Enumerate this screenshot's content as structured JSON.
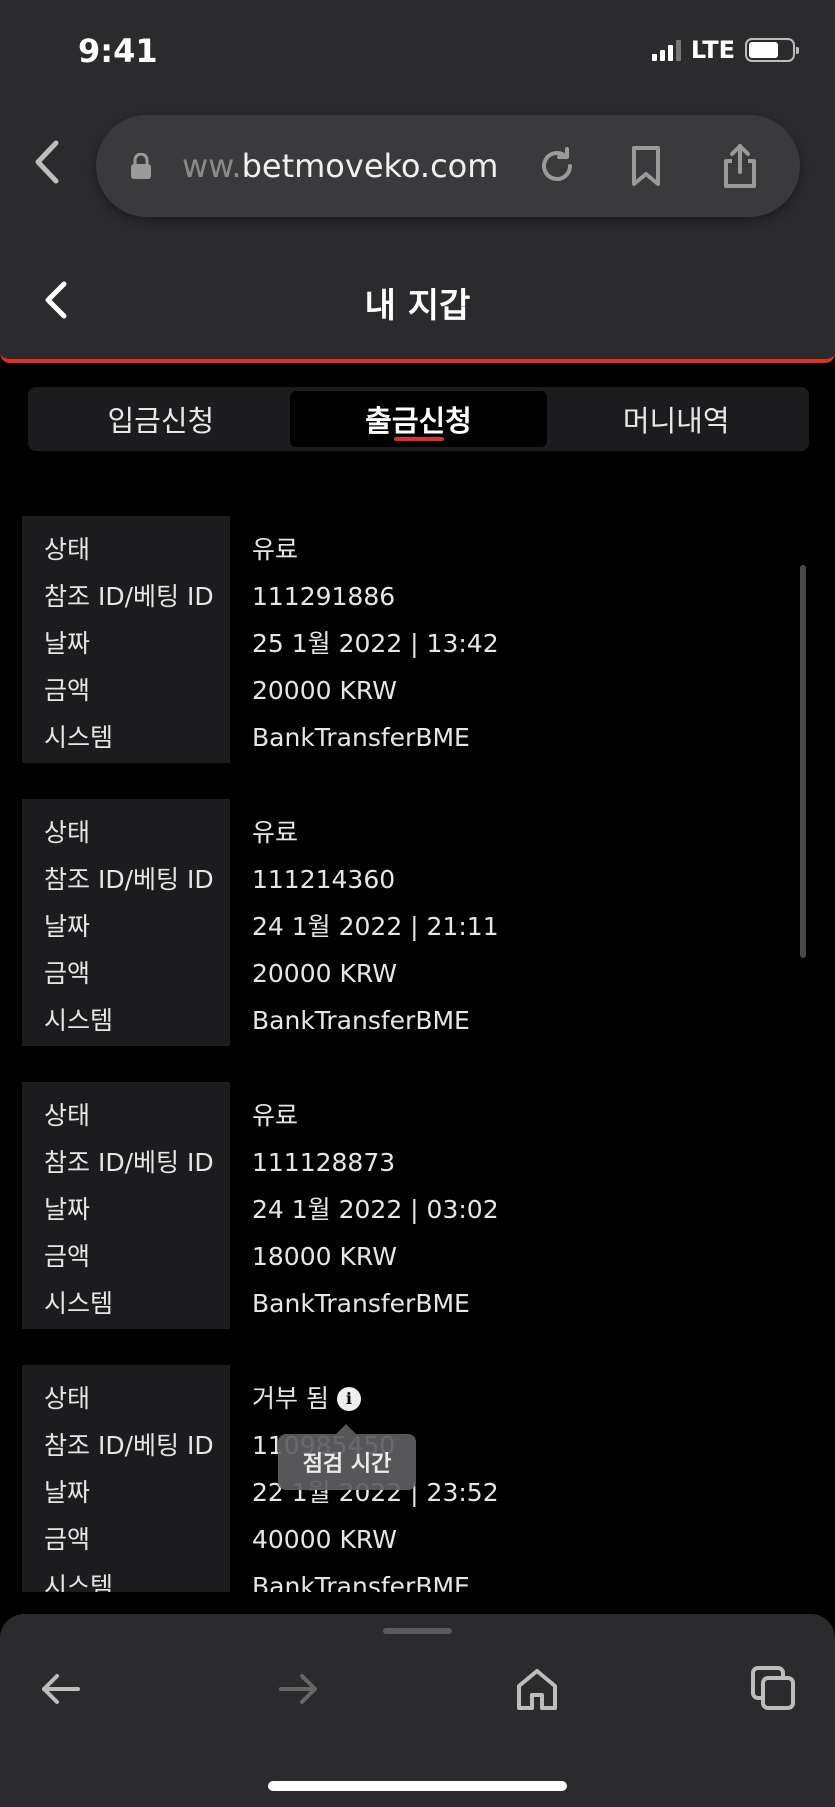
{
  "status_bar": {
    "time": "9:41",
    "network": "LTE",
    "battery_level": 0.7
  },
  "browser": {
    "url_prefix": "ww.",
    "url_main": "betmoveko.com",
    "icons": [
      "back-icon",
      "lock-icon",
      "reload-icon",
      "bookmark-icon",
      "share-icon"
    ]
  },
  "header": {
    "title": "내 지갑"
  },
  "tabs": [
    {
      "label": "입금신청",
      "active": false
    },
    {
      "label": "출금신청",
      "active": true
    },
    {
      "label": "머니내역",
      "active": false
    }
  ],
  "field_labels": {
    "status": "상태",
    "ref_id": "참조 ID/베팅 ID",
    "date": "날짜",
    "amount": "금액",
    "system": "시스템"
  },
  "records": [
    {
      "status": "유료",
      "ref_id": "111291886",
      "date": "25 1월 2022 | 13:42",
      "amount": "20000 KRW",
      "system": "BankTransferBME"
    },
    {
      "status": "유료",
      "ref_id": "111214360",
      "date": "24 1월 2022 | 21:11",
      "amount": "20000 KRW",
      "system": "BankTransferBME"
    },
    {
      "status": "유료",
      "ref_id": "111128873",
      "date": "24 1월 2022 | 03:02",
      "amount": "18000 KRW",
      "system": "BankTransferBME"
    },
    {
      "status": "거부 됨",
      "ref_id": "110985450",
      "date": "22 1월 2022 | 23:52",
      "amount": "40000 KRW",
      "system": "BankTransferBME",
      "has_info": true
    }
  ],
  "tooltip": {
    "text": "점검 시간"
  },
  "toolbar": {
    "icons": [
      "back-arrow-icon",
      "forward-arrow-icon",
      "home-icon",
      "tabs-icon"
    ]
  }
}
